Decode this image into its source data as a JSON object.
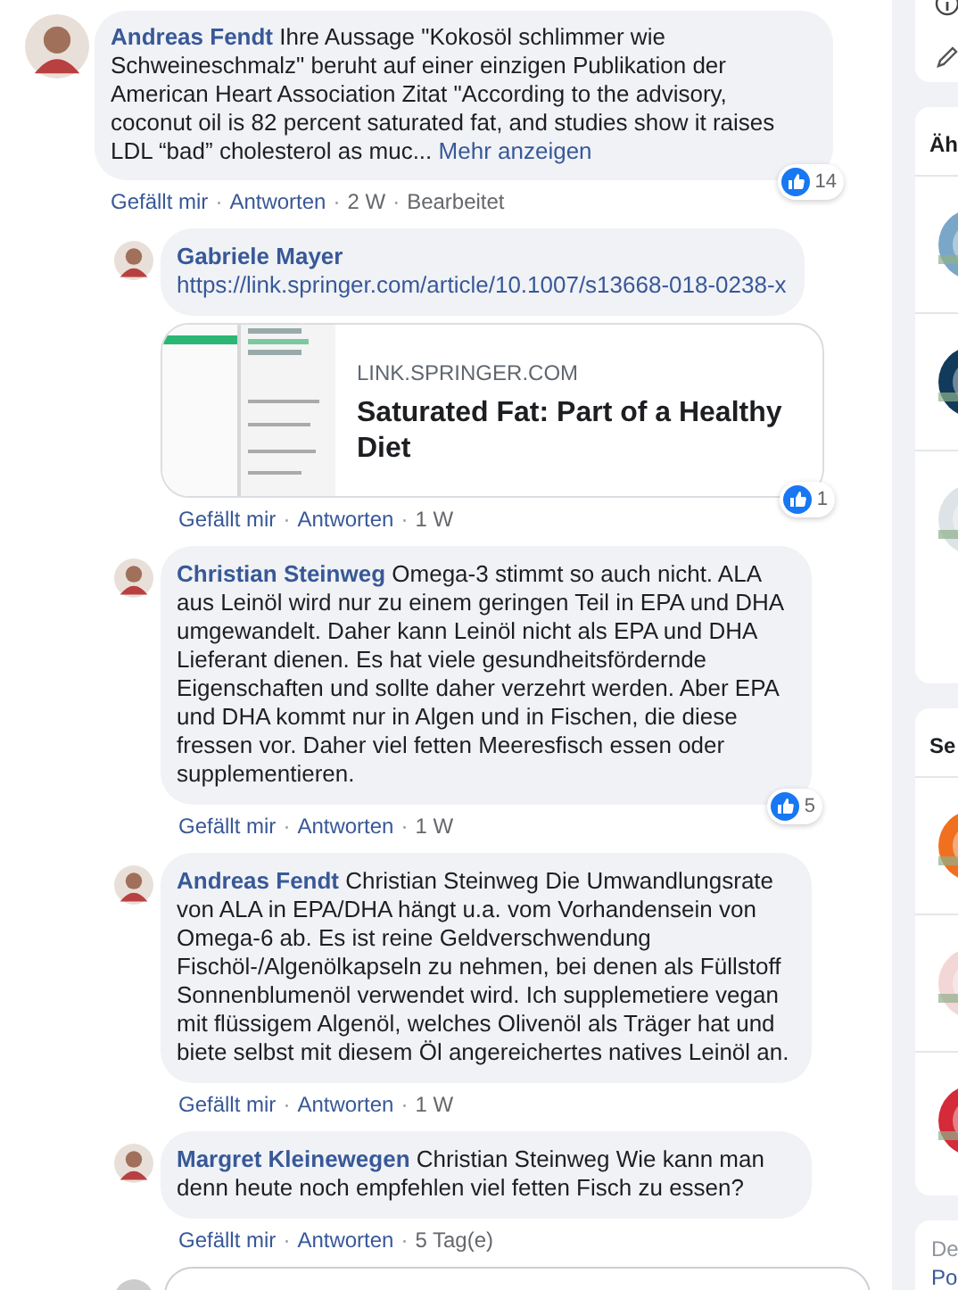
{
  "separator": "·",
  "comment": {
    "author": "Andreas Fendt",
    "text": "Ihre Aussage \"Kokosöl schlimmer wie Schweineschmalz\" beruht auf einer einzigen Publikation der American Heart Association Zitat \"According to the advisory, coconut oil is 82 percent saturated fat, and studies show it raises LDL “bad” cholesterol as muc...",
    "more": "Mehr anzeigen",
    "like": "Gefällt mir",
    "reply": "Antworten",
    "time": "2 W",
    "edited": "Bearbeitet",
    "reactions": "14",
    "replies": [
      {
        "author": "Gabriele Mayer",
        "link": "https://link.springer.com/article/10.1007/s13668-018-0238-x",
        "preview": {
          "domain": "LINK.SPRINGER.COM",
          "title": "Saturated Fat: Part of a Healthy Diet"
        },
        "like": "Gefällt mir",
        "reply": "Antworten",
        "time": "1 W",
        "reactions": "1"
      },
      {
        "author": "Christian Steinweg",
        "text": "Omega-3 stimmt so auch nicht. ALA aus Leinöl wird nur zu einem geringen Teil in EPA und DHA umgewandelt. Daher kann Leinöl nicht als EPA und DHA Lieferant dienen. Es hat viele gesundheitsfördernde Eigenschaften und sollte daher verzehrt werden. Aber EPA und DHA kommt nur in Algen und in Fischen, die diese fressen vor. Daher viel fetten Meeresfisch essen oder supplementieren.",
        "like": "Gefällt mir",
        "reply": "Antworten",
        "time": "1 W",
        "reactions": "5"
      },
      {
        "author": "Andreas Fendt",
        "text": "Christian Steinweg Die Umwandlungsrate von ALA in EPA/DHA hängt u.a. vom Vorhandensein von Omega-6 ab. Es ist reine Geldverschwendung Fischöl-/Algenölkapseln zu nehmen, bei denen als Füllstoff Sonnenblumenöl verwendet wird. Ich supplemetiere vegan mit flüssigem Algenöl, welches Olivenöl als Träger hat und biete selbst mit diesem Öl angereichertes natives Leinöl an.",
        "like": "Gefällt mir",
        "reply": "Antworten",
        "time": "1 W"
      },
      {
        "author": "Margret Kleinewegen",
        "text": "Christian Steinweg Wie kann man denn heute noch empfehlen viel fetten Fisch zu essen?",
        "like": "Gefällt mir",
        "reply": "Antworten",
        "time": "5 Tag(e)"
      }
    ]
  },
  "sidebar": {
    "cards": [
      {
        "kind": "tools"
      },
      {
        "kind": "list",
        "heading": "Äh"
      },
      {
        "kind": "list",
        "heading": "Se"
      },
      {
        "kind": "footer",
        "heading": "De",
        "link": "Po"
      }
    ]
  }
}
